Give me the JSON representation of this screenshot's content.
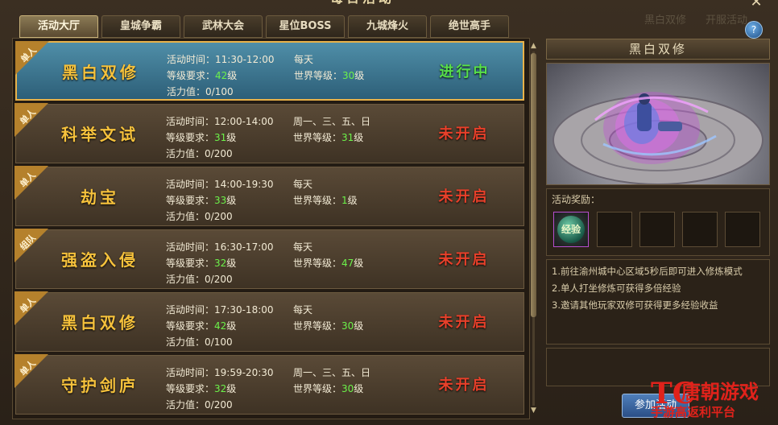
{
  "window": {
    "title": "每日活动",
    "close_glyph": "✕",
    "bg_labels": [
      "黑白双修",
      "开服活动"
    ],
    "help_glyph": "?"
  },
  "tabs": [
    {
      "label": "活动大厅",
      "active": true
    },
    {
      "label": "皇城争霸",
      "active": false
    },
    {
      "label": "武林大会",
      "active": false
    },
    {
      "label": "星位BOSS",
      "active": false
    },
    {
      "label": "九城烽火",
      "active": false
    },
    {
      "label": "绝世高手",
      "active": false
    }
  ],
  "labels": {
    "time": "活动时间：",
    "level_req": "等级要求：",
    "world_level": "世界等级：",
    "activity": "活力值：",
    "level_unit": "级"
  },
  "activities": [
    {
      "badge": "单人",
      "name": "黑白双修",
      "time": "11:30-12:00",
      "days": "每天",
      "level": "42",
      "world_level": "30",
      "activity_value": "0/100",
      "status": "进行中",
      "running": true
    },
    {
      "badge": "单人",
      "name": "科举文试",
      "time": "12:00-14:00",
      "days": "周一、三、五、日",
      "level": "31",
      "world_level": "31",
      "activity_value": "0/200",
      "status": "未开启",
      "running": false
    },
    {
      "badge": "单人",
      "name": "劫宝",
      "time": "14:00-19:30",
      "days": "每天",
      "level": "33",
      "world_level": "1",
      "activity_value": "0/200",
      "status": "未开启",
      "running": false
    },
    {
      "badge": "组队",
      "name": "强盗入侵",
      "time": "16:30-17:00",
      "days": "每天",
      "level": "32",
      "world_level": "47",
      "activity_value": "0/200",
      "status": "未开启",
      "running": false
    },
    {
      "badge": "单人",
      "name": "黑白双修",
      "time": "17:30-18:00",
      "days": "每天",
      "level": "42",
      "world_level": "30",
      "activity_value": "0/100",
      "status": "未开启",
      "running": false
    },
    {
      "badge": "单人",
      "name": "守护剑庐",
      "time": "19:59-20:30",
      "days": "周一、三、五、日",
      "level": "32",
      "world_level": "30",
      "activity_value": "0/200",
      "status": "未开启",
      "running": false
    }
  ],
  "side": {
    "title": "黑白双修",
    "reward_label": "活动奖励：",
    "reward_item": "经验",
    "description": [
      "1.前往渝州城中心区域5秒后即可进入修炼模式",
      "2.单人打坐修炼可获得多倍经验",
      "3.邀请其他玩家双修可获得更多经验收益"
    ],
    "join_button": "参加活动"
  },
  "watermark": {
    "logo": "TC",
    "line1": "唐朝游戏",
    "line2": "手游高返利平台"
  },
  "colors": {
    "running": "#58e04a",
    "not_started": "#e8402a",
    "activity_name": "#f6c23c",
    "level_number": "#6cf24a",
    "selected_border": "#e8b24a"
  }
}
